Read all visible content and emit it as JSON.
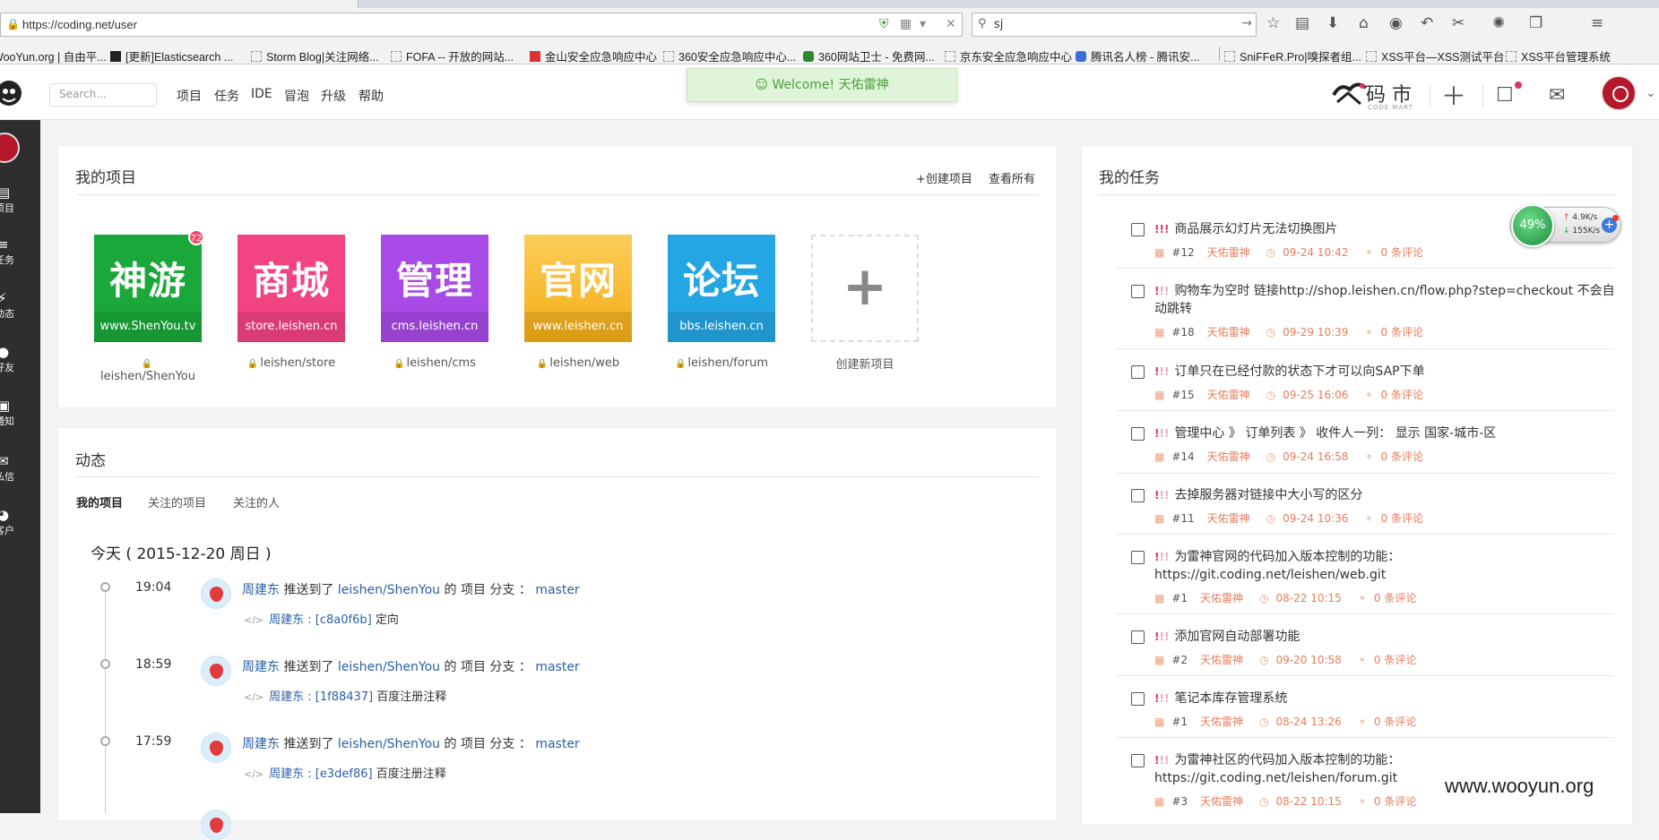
{
  "browser": {
    "url": "https://coding.net/user",
    "search_value": "sj",
    "bookmarks": [
      "WooYun.org | 自由平...",
      "[更新]Elasticsearch ...",
      "Storm Blog|关注网络...",
      "FOFA -- 开放的网站...",
      "金山安全应急响应中心",
      "360安全应急响应中心...",
      "360网站卫士 - 免费网...",
      "京东安全应急响应中心",
      "腾讯名人榜 - 腾讯安...",
      "SniFFeR.Pro|嗅探者组...",
      "XSS平台—XSS测试平台",
      "XSS平台管理系统"
    ]
  },
  "header": {
    "search_placeholder": "Search...",
    "nav": [
      "项目",
      "任务",
      "IDE",
      "冒泡",
      "升级",
      "帮助"
    ],
    "welcome": "Welcome! 天佑雷神",
    "brand_main": "码 市",
    "brand_sub": "CODE MART"
  },
  "sidebar": {
    "items": [
      "项目",
      "任务",
      "动态",
      "好友",
      "通知",
      "私信",
      "客户"
    ]
  },
  "projects": {
    "title": "我的项目",
    "create_link": "+创建项目",
    "view_all_link": "查看所有",
    "items": [
      {
        "big": "神游",
        "sub": "www.ShenYou.tv",
        "name": "leishen/ShenYou",
        "color": "#1aa83a",
        "badge": "72"
      },
      {
        "big": "商城",
        "sub": "store.leishen.cn",
        "name": "leishen/store",
        "color": "#f24383"
      },
      {
        "big": "管理",
        "sub": "cms.leishen.cn",
        "name": "leishen/cms",
        "color": "#a74ae6"
      },
      {
        "big": "官网",
        "sub": "www.leishen.cn",
        "name": "leishen/web",
        "color": "#f8be2c"
      },
      {
        "big": "论坛",
        "sub": "bbs.leishen.cn",
        "name": "leishen/forum",
        "color": "#23a6e2"
      }
    ],
    "new_label": "创建新项目"
  },
  "activity": {
    "title": "动态",
    "tabs": [
      "我的项目",
      "关注的项目",
      "关注的人"
    ],
    "today": "今天 ( 2015-12-20 周日 )",
    "events": [
      {
        "time": "19:04",
        "user": "周建东",
        "verb": " 推送到了 ",
        "repo": "leishen/ShenYou",
        "mid": " 的 项目 分支 ： ",
        "branch": "master",
        "commit": "周建东 : [c8a0f6b]",
        "msg": " 定向"
      },
      {
        "time": "18:59",
        "user": "周建东",
        "verb": " 推送到了 ",
        "repo": "leishen/ShenYou",
        "mid": " 的 项目 分支 ： ",
        "branch": "master",
        "commit": "周建东 : [1f88437]",
        "msg": " 百度注册注释"
      },
      {
        "time": "17:59",
        "user": "周建东",
        "verb": " 推送到了 ",
        "repo": "leishen/ShenYou",
        "mid": " 的 项目 分支 ： ",
        "branch": "master",
        "commit": "周建东 : [e3def86]",
        "msg": " 百度注册注释"
      }
    ]
  },
  "tasks": {
    "title": "我的任务",
    "items": [
      {
        "pri": "!!!",
        "title": "商品展示幻灯片无法切换图片",
        "num": "#12",
        "owner": "天佑雷神",
        "time": "09-24 10:42",
        "comments": "0 条评论"
      },
      {
        "pri": "!!!",
        "title": "购物车为空时 链接http://shop.leishen.cn/flow.php?step=checkout 不会自动跳转",
        "num": "#18",
        "owner": "天佑雷神",
        "time": "09-29 10:39",
        "comments": "0 条评论"
      },
      {
        "pri": "!!!",
        "title": "订单只在已经付款的状态下才可以向SAP下单",
        "num": "#15",
        "owner": "天佑雷神",
        "time": "09-25 16:06",
        "comments": "0 条评论"
      },
      {
        "pri": "!!!",
        "title": "管理中心 》 订单列表 》 收件人一列： 显示 国家-城市-区",
        "num": "#14",
        "owner": "天佑雷神",
        "time": "09-24 16:58",
        "comments": "0 条评论"
      },
      {
        "pri": "!!!",
        "title": "去掉服务器对链接中大小写的区分",
        "num": "#11",
        "owner": "天佑雷神",
        "time": "09-24 10:36",
        "comments": "0 条评论"
      },
      {
        "pri": "!!!",
        "title": "为雷神官网的代码加入版本控制的功能： https://git.coding.net/leishen/web.git",
        "num": "#1",
        "owner": "天佑雷神",
        "time": "08-22 10:15",
        "comments": "0 条评论"
      },
      {
        "pri": "!!!",
        "title": "添加官网自动部署功能",
        "num": "#2",
        "owner": "天佑雷神",
        "time": "09-20 10:58",
        "comments": "0 条评论"
      },
      {
        "pri": "!!!",
        "title": "笔记本库存管理系统",
        "num": "#1",
        "owner": "天佑雷神",
        "time": "08-24 13:26",
        "comments": "0 条评论"
      },
      {
        "pri": "!!!",
        "title": "为雷神社区的代码加入版本控制的功能： https://git.coding.net/leishen/forum.git",
        "num": "#3",
        "owner": "天佑雷神",
        "time": "08-22 10:15",
        "comments": "0 条评论"
      }
    ]
  },
  "net_widget": {
    "percent": "49%",
    "up": "4.9K/s",
    "down": "155K/s"
  },
  "watermark": "www.wooyun.org"
}
